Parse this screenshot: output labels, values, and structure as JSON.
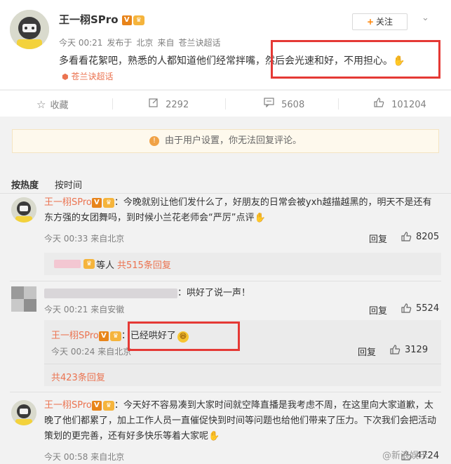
{
  "post": {
    "username": "王一栩SPro",
    "verified_badge": "V",
    "time": "今天 00:21",
    "posted_from_label": "发布于",
    "location": "北京",
    "source_label": "来自",
    "source": "苍兰诀超话",
    "text": "多看看花絮吧，熟悉的人都知道他们经常拌嘴，然后会光速和好，不用担心。",
    "topic": "苍兰诀超话",
    "follow_label": "关注"
  },
  "actions": {
    "favorite": "收藏",
    "repost": "2292",
    "comment": "5608",
    "like": "101204"
  },
  "notice": "由于用户设置，你无法回复评论。",
  "sort": {
    "hot": "按热度",
    "time": "按时间"
  },
  "comments": [
    {
      "name": "王一栩SPro",
      "text_line1": "：今晚就别让他们发什么了，好朋友的日常会被yxh越描越黑的，明天不是还有",
      "text_line2": "东方强的女团舞吗，到时候小兰花老师会“严厉”点评",
      "time": "今天 00:33 来自北京",
      "reply": "回复",
      "likes": "8205",
      "sub_suffix": "等人",
      "sub_count": "共515条回复"
    },
    {
      "text": "：哄好了说一声！",
      "time": "今天 00:21 来自安徽",
      "reply": "回复",
      "likes": "5524",
      "sub_name": "王一栩SPro",
      "sub_text": "：已经哄好了",
      "sub_time": "今天 00:24 来自北京",
      "sub_reply": "回复",
      "sub_likes": "3129",
      "sub_count": "共423条回复"
    },
    {
      "name": "王一栩SPro",
      "text_line1": "：今天好不容易凑到大家时间就空降直播是我考虑不周，在这里向大家道歉，太",
      "text_line2": "晚了他们都累了，加上工作人员一直催促快到时间等问题也给他们带来了压力。下次我们会把活动",
      "text_line3": "策划的更完善，还有好多快乐等着大家呢",
      "time": "今天 00:58 来自北京",
      "likes": "4724"
    }
  ],
  "watermark": "@新浪娱乐",
  "colors": {
    "accent": "#eb7350",
    "highlight_box": "#e53935",
    "orange": "#ff8200"
  }
}
